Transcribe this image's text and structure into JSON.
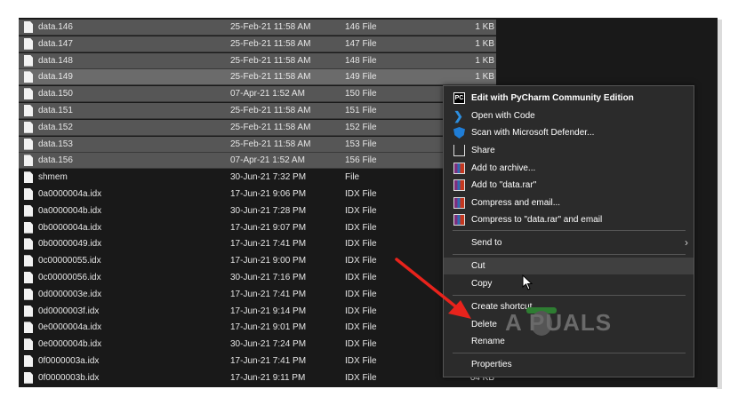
{
  "files": [
    {
      "name": "data.146",
      "date": "25-Feb-21 11:58 AM",
      "type": "146 File",
      "size": "1 KB",
      "selected": true
    },
    {
      "name": "data.147",
      "date": "25-Feb-21 11:58 AM",
      "type": "147 File",
      "size": "1 KB",
      "selected": true
    },
    {
      "name": "data.148",
      "date": "25-Feb-21 11:58 AM",
      "type": "148 File",
      "size": "1 KB",
      "selected": true
    },
    {
      "name": "data.149",
      "date": "25-Feb-21 11:58 AM",
      "type": "149 File",
      "size": "1 KB",
      "selected": true
    },
    {
      "name": "data.150",
      "date": "07-Apr-21 1:52 AM",
      "type": "150 File",
      "size": "",
      "selected": true
    },
    {
      "name": "data.151",
      "date": "25-Feb-21 11:58 AM",
      "type": "151 File",
      "size": "",
      "selected": true
    },
    {
      "name": "data.152",
      "date": "25-Feb-21 11:58 AM",
      "type": "152 File",
      "size": "",
      "selected": true
    },
    {
      "name": "data.153",
      "date": "25-Feb-21 11:58 AM",
      "type": "153 File",
      "size": "",
      "selected": true
    },
    {
      "name": "data.156",
      "date": "07-Apr-21 1:52 AM",
      "type": "156 File",
      "size": "",
      "selected": true
    },
    {
      "name": "shmem",
      "date": "30-Jun-21 7:32 PM",
      "type": "File",
      "size": "",
      "selected": false
    },
    {
      "name": "0a0000004a.idx",
      "date": "17-Jun-21 9:06 PM",
      "type": "IDX File",
      "size": "",
      "selected": false
    },
    {
      "name": "0a0000004b.idx",
      "date": "30-Jun-21 7:28 PM",
      "type": "IDX File",
      "size": "",
      "selected": false
    },
    {
      "name": "0b0000004a.idx",
      "date": "17-Jun-21 9:07 PM",
      "type": "IDX File",
      "size": "",
      "selected": false
    },
    {
      "name": "0b00000049.idx",
      "date": "17-Jun-21 7:41 PM",
      "type": "IDX File",
      "size": "",
      "selected": false
    },
    {
      "name": "0c00000055.idx",
      "date": "17-Jun-21 9:00 PM",
      "type": "IDX File",
      "size": "",
      "selected": false
    },
    {
      "name": "0c00000056.idx",
      "date": "30-Jun-21 7:16 PM",
      "type": "IDX File",
      "size": "",
      "selected": false
    },
    {
      "name": "0d0000003e.idx",
      "date": "17-Jun-21 7:41 PM",
      "type": "IDX File",
      "size": "",
      "selected": false
    },
    {
      "name": "0d0000003f.idx",
      "date": "17-Jun-21 9:14 PM",
      "type": "IDX File",
      "size": "",
      "selected": false
    },
    {
      "name": "0e0000004a.idx",
      "date": "17-Jun-21 9:01 PM",
      "type": "IDX File",
      "size": "",
      "selected": false
    },
    {
      "name": "0e0000004b.idx",
      "date": "30-Jun-21 7:24 PM",
      "type": "IDX File",
      "size": "",
      "selected": false
    },
    {
      "name": "0f0000003a.idx",
      "date": "17-Jun-21 7:41 PM",
      "type": "IDX File",
      "size": "",
      "selected": false
    },
    {
      "name": "0f0000003b.idx",
      "date": "17-Jun-21 9:11 PM",
      "type": "IDX File",
      "size": "64 KB",
      "selected": false
    }
  ],
  "context_menu": {
    "items": [
      {
        "label": "Edit with PyCharm Community Edition",
        "icon": "pycharm-icon",
        "icon_text": "PC",
        "bold": true
      },
      {
        "label": "Open with Code",
        "icon": "vscode-icon",
        "icon_text": "❯"
      },
      {
        "label": "Scan with Microsoft Defender...",
        "icon": "defender-shield-icon"
      },
      {
        "label": "Share",
        "icon": "share-icon"
      },
      {
        "label": "Add to archive...",
        "icon": "winrar-icon"
      },
      {
        "label": "Add to \"data.rar\"",
        "icon": "winrar-icon"
      },
      {
        "label": "Compress and email...",
        "icon": "winrar-icon"
      },
      {
        "label": "Compress to \"data.rar\" and email",
        "icon": "winrar-icon"
      },
      {
        "label": "Send to",
        "icon": "",
        "submenu": true,
        "chevron": "›"
      },
      {
        "label": "Cut",
        "icon": "",
        "highlighted": true
      },
      {
        "label": "Copy",
        "icon": ""
      },
      {
        "label": "Create shortcut",
        "icon": ""
      },
      {
        "label": "Delete",
        "icon": ""
      },
      {
        "label": "Rename",
        "icon": ""
      },
      {
        "label": "Properties",
        "icon": ""
      }
    ]
  },
  "watermark": {
    "text": "A PUALS"
  },
  "colors": {
    "background": "#191919",
    "selection": "#565656",
    "menu": "#2b2b2b",
    "arrow": "#e8231c"
  }
}
